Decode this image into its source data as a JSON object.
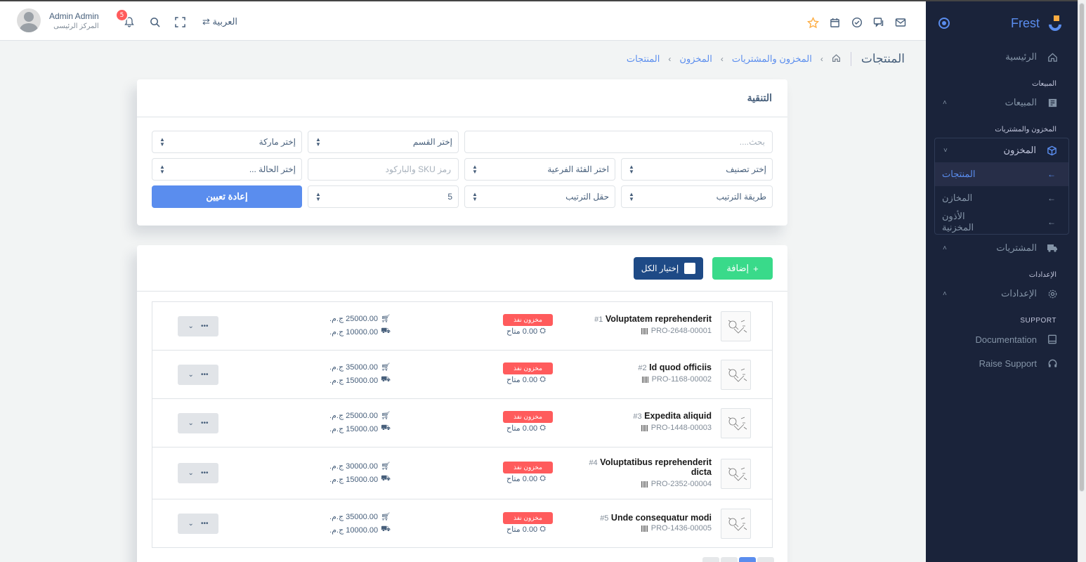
{
  "sidebar": {
    "brand": "Frest",
    "home": "الرئيسية",
    "sec_sales": "المبيعات",
    "sales": "المبيعات",
    "sec_inventory": "المخزون والمشتريات",
    "inventory": "المخزون",
    "sub_items": [
      "المنتجات",
      "المخازن",
      "الأذون المخزنية"
    ],
    "purchases": "المشتريات",
    "sec_settings": "الإعدادات",
    "settings": "الإعدادات",
    "sec_support": "SUPPORT",
    "documentation": "Documentation",
    "raise_support": "Raise Support"
  },
  "navbar": {
    "user_name": "Admin Admin",
    "user_role": "المركز الرئيسى",
    "notif_count": "5",
    "language": "العربية"
  },
  "breadcrumb": {
    "title": "المنتجات",
    "items": [
      "المخزون والمشتريات",
      "المخزون",
      "المنتجات"
    ]
  },
  "filter": {
    "title": "التنقية",
    "search_placeholder": "بحث....",
    "category": "إختر القسم",
    "brand": "إختر ماركة",
    "classification": "إختر تصنيف",
    "subcategory": "اختر الفئة الفرعية",
    "sku_placeholder": "رمز SKU والباركود",
    "status": "إختر الحالة ...",
    "sort_method": "طريقة الترتيب",
    "sort_field": "حقل الترتيب",
    "per_page": "5",
    "reset": "إعادة تعيين"
  },
  "list": {
    "add": "إضافة",
    "select_all": "إختيار الكل",
    "rows": [
      {
        "num": "#1",
        "name": "Voluptatem reprehenderit",
        "sku": "PRO-2648-00001",
        "status": "مخزون نفذ",
        "avail": "0.00 متاح",
        "sell": "25000.00 ج.م.",
        "buy": "10000.00 ج.م."
      },
      {
        "num": "#2",
        "name": "Id quod officiis",
        "sku": "PRO-1168-00002",
        "status": "مخزون نفذ",
        "avail": "0.00 متاح",
        "sell": "35000.00 ج.م.",
        "buy": "15000.00 ج.م."
      },
      {
        "num": "#3",
        "name": "Expedita aliquid",
        "sku": "PRO-1448-00003",
        "status": "مخزون نفذ",
        "avail": "0.00 متاح",
        "sell": "25000.00 ج.م.",
        "buy": "15000.00 ج.م."
      },
      {
        "num": "#4",
        "name": "Voluptatibus reprehenderit dicta",
        "sku": "PRO-2352-00004",
        "status": "مخزون نفذ",
        "avail": "0.00 متاح",
        "sell": "30000.00 ج.م.",
        "buy": "15000.00 ج.م."
      },
      {
        "num": "#5",
        "name": "Unde consequatur modi",
        "sku": "PRO-1436-00005",
        "status": "مخزون نفذ",
        "avail": "0.00 متاح",
        "sell": "35000.00 ج.م.",
        "buy": "10000.00 ج.م."
      }
    ],
    "action_dots": "•••",
    "action_caret": "⌄"
  },
  "colors": {
    "primary": "#5a8dee",
    "success": "#39da8a",
    "danger": "#ff5b5c",
    "sidebar_bg": "#1a233a",
    "dark_button": "#1e4a86"
  }
}
